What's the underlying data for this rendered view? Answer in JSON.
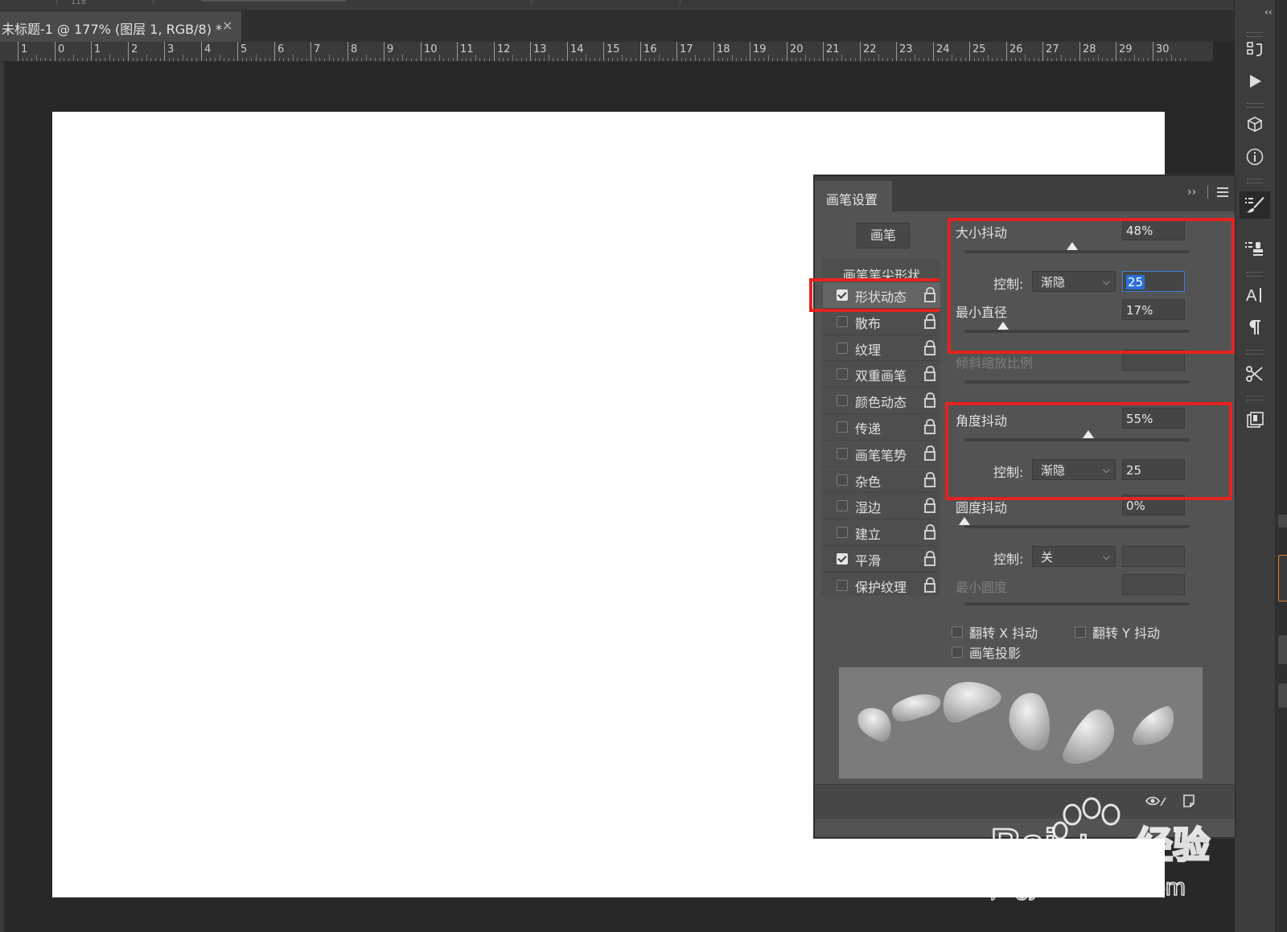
{
  "document": {
    "tab_title": "未标题-1 @ 177% (图层 1, RGB/8) *",
    "close_glyph": "×",
    "top_strip_number": "118"
  },
  "ruler": {
    "labels": [
      "1",
      "0",
      "1",
      "2",
      "3",
      "4",
      "5",
      "6",
      "7",
      "8",
      "9",
      "10",
      "11",
      "12",
      "13",
      "14",
      "15",
      "16",
      "17",
      "18",
      "19",
      "20",
      "21",
      "22",
      "23",
      "24",
      "25",
      "26",
      "27",
      "28",
      "29",
      "30"
    ]
  },
  "dock": {
    "collapse_glyph": "‹‹",
    "icons": [
      "history-icon",
      "play-actions-icon",
      "3d-icon",
      "info-icon",
      "brush-settings-icon",
      "clone-source-icon",
      "character-icon",
      "paragraph-icon",
      "tool-presets-icon",
      "layer-comps-icon"
    ]
  },
  "brush_settings": {
    "tab_label": "画笔设置",
    "expand_glyph": "››",
    "brushes_button": "画笔",
    "tip_shape_label": "画笔笔尖形状",
    "items": [
      {
        "label": "形状动态",
        "checked": true,
        "selected": true
      },
      {
        "label": "散布",
        "checked": false
      },
      {
        "label": "纹理",
        "checked": false
      },
      {
        "label": "双重画笔",
        "checked": false
      },
      {
        "label": "颜色动态",
        "checked": false
      },
      {
        "label": "传递",
        "checked": false
      },
      {
        "label": "画笔笔势",
        "checked": false
      },
      {
        "label": "杂色",
        "checked": false
      },
      {
        "label": "湿边",
        "checked": false
      },
      {
        "label": "建立",
        "checked": false
      },
      {
        "label": "平滑",
        "checked": true
      },
      {
        "label": "保护纹理",
        "checked": false
      }
    ],
    "size_jitter": {
      "label": "大小抖动",
      "value": "48%",
      "level": 0.48
    },
    "size_control": {
      "label": "控制:",
      "mode": "渐隐",
      "steps": "25"
    },
    "min_diameter": {
      "label": "最小直径",
      "value": "17%",
      "level": 0.17
    },
    "tilt_scale": {
      "label": "倾斜缩放比例"
    },
    "angle_jitter": {
      "label": "角度抖动",
      "value": "55%",
      "level": 0.55
    },
    "angle_control": {
      "label": "控制:",
      "mode": "渐隐",
      "steps": "25"
    },
    "roundness_jitter": {
      "label": "圆度抖动",
      "value": "0%",
      "level": 0.0
    },
    "roundness_control": {
      "label": "控制:",
      "mode": "关"
    },
    "min_roundness": {
      "label": "最小圆度"
    },
    "flip_x": "翻转 X 抖动",
    "flip_y": "翻转 Y 抖动",
    "brush_projection": "画笔投影"
  },
  "colors": {
    "highlight": "#e52320",
    "panel": "#535353",
    "canvas": "#ffffff"
  },
  "watermark": {
    "line1": "Bai经验",
    "du": "du",
    "line2": "jingyan.baidu.com"
  }
}
